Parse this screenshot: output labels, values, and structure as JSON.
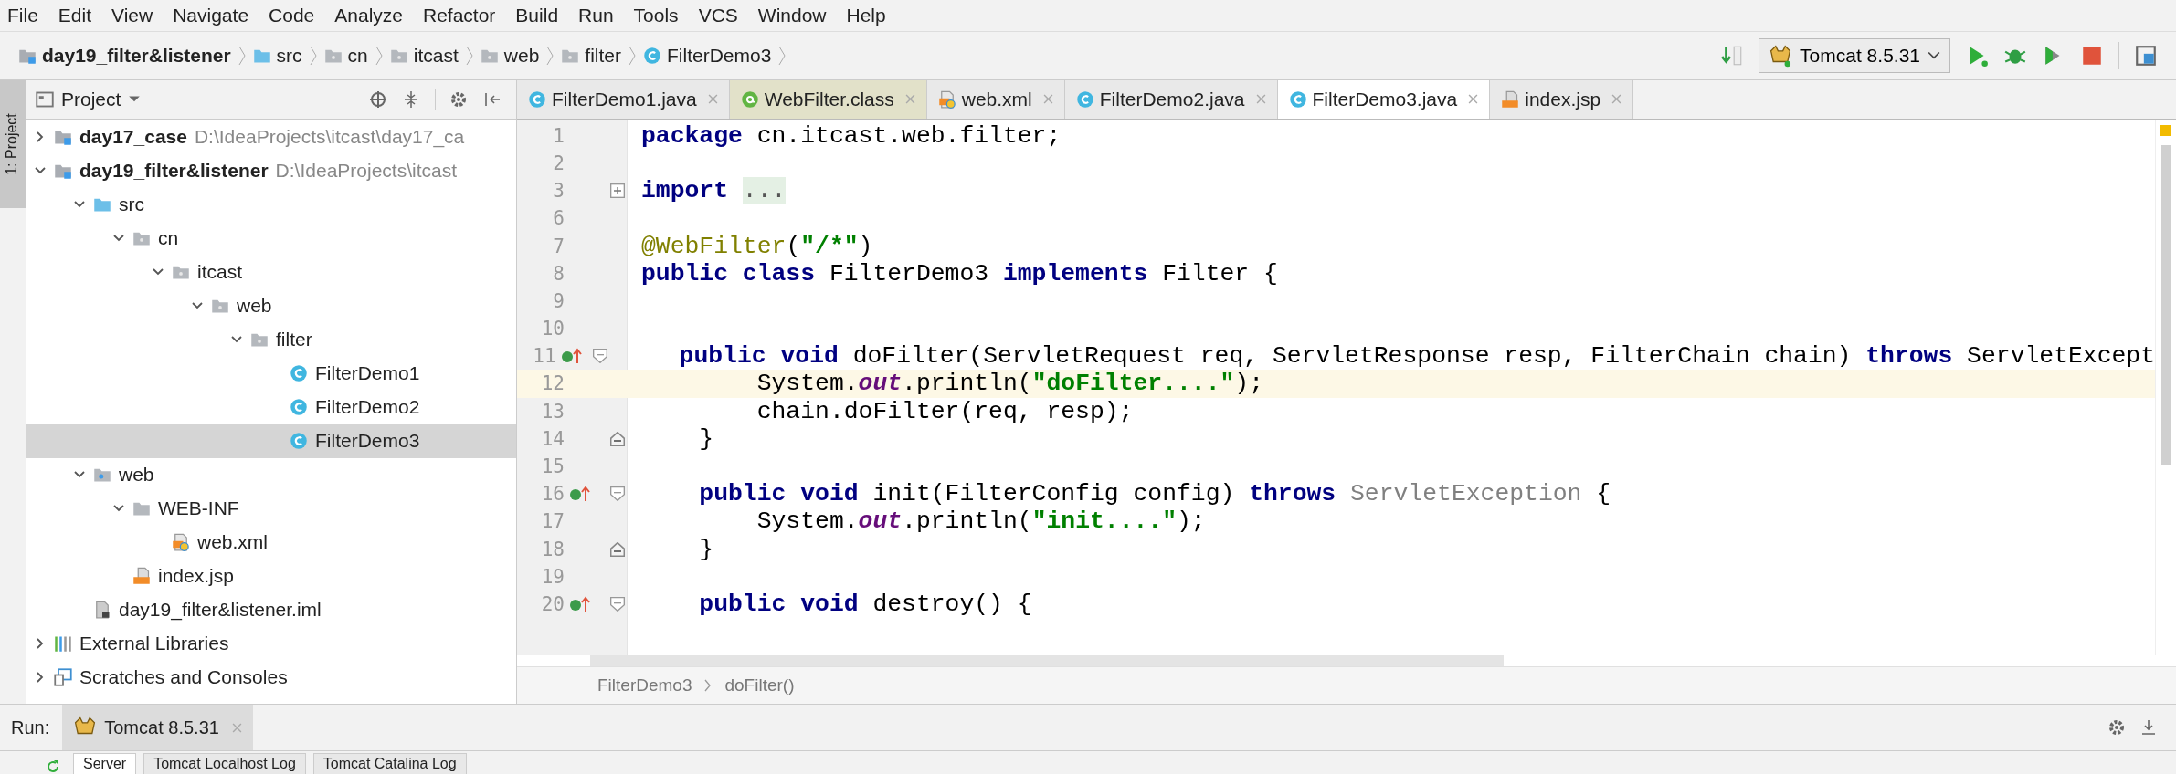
{
  "menu": [
    "File",
    "Edit",
    "View",
    "Navigate",
    "Code",
    "Analyze",
    "Refactor",
    "Build",
    "Run",
    "Tools",
    "VCS",
    "Window",
    "Help"
  ],
  "breadcrumb": [
    {
      "label": "day19_filter&listener",
      "kind": "module"
    },
    {
      "label": "src",
      "kind": "source"
    },
    {
      "label": "cn",
      "kind": "package"
    },
    {
      "label": "itcast",
      "kind": "package"
    },
    {
      "label": "web",
      "kind": "package"
    },
    {
      "label": "filter",
      "kind": "package"
    },
    {
      "label": "FilterDemo3",
      "kind": "class"
    }
  ],
  "run_config": {
    "label": "Tomcat 8.5.31"
  },
  "side_strip": {
    "label": "1: Project",
    "selected": true
  },
  "project_panel": {
    "title": "Project",
    "tree": [
      {
        "label": "day17_case",
        "detail": "D:\\IdeaProjects\\itcast\\day17_ca",
        "kind": "module",
        "expanded": false,
        "selected": false
      },
      {
        "label": "day19_filter&listener",
        "detail": "D:\\IdeaProjects\\itcast",
        "kind": "module",
        "expanded": true,
        "selected": false,
        "children": [
          {
            "label": "src",
            "kind": "source",
            "expanded": true,
            "selected": false,
            "children": [
              {
                "label": "cn",
                "kind": "package",
                "expanded": true,
                "selected": false,
                "children": [
                  {
                    "label": "itcast",
                    "kind": "package",
                    "expanded": true,
                    "selected": false,
                    "children": [
                      {
                        "label": "web",
                        "kind": "package",
                        "expanded": true,
                        "selected": false,
                        "children": [
                          {
                            "label": "filter",
                            "kind": "package",
                            "expanded": true,
                            "selected": false,
                            "children": [
                              {
                                "label": "FilterDemo1",
                                "kind": "class",
                                "selected": false
                              },
                              {
                                "label": "FilterDemo2",
                                "kind": "class",
                                "selected": false
                              },
                              {
                                "label": "FilterDemo3",
                                "kind": "class",
                                "selected": true
                              }
                            ]
                          }
                        ]
                      }
                    ]
                  }
                ]
              }
            ]
          },
          {
            "label": "web",
            "kind": "webroot",
            "expanded": true,
            "selected": false,
            "children": [
              {
                "label": "WEB-INF",
                "kind": "folder",
                "expanded": true,
                "selected": false,
                "children": [
                  {
                    "label": "web.xml",
                    "kind": "xml",
                    "selected": false
                  }
                ]
              },
              {
                "label": "index.jsp",
                "kind": "jsp",
                "selected": false
              }
            ]
          },
          {
            "label": "day19_filter&listener.iml",
            "kind": "iml",
            "selected": false
          }
        ]
      },
      {
        "label": "External Libraries",
        "kind": "libraries",
        "expanded": false,
        "selected": false
      },
      {
        "label": "Scratches and Consoles",
        "kind": "scratches",
        "expanded": false,
        "selected": false
      }
    ]
  },
  "tabs": [
    {
      "label": "FilterDemo1.java",
      "kind": "class",
      "selected": false
    },
    {
      "label": "WebFilter.class",
      "kind": "annotation",
      "selected": false
    },
    {
      "label": "web.xml",
      "kind": "xml",
      "selected": false
    },
    {
      "label": "FilterDemo2.java",
      "kind": "class",
      "selected": false
    },
    {
      "label": "FilterDemo3.java",
      "kind": "class",
      "selected": true
    },
    {
      "label": "index.jsp",
      "kind": "jsp",
      "selected": false
    }
  ],
  "editor": {
    "lines": [
      {
        "number": "1",
        "current": false,
        "overrides": false,
        "fold_start": false,
        "fold_end": false,
        "collapsed": false,
        "tokens": [
          {
            "kind": "kw",
            "text": "package"
          },
          {
            "kind": "plain",
            "text": " cn.itcast.web.filter;"
          }
        ]
      },
      {
        "number": "2",
        "current": false,
        "overrides": false,
        "fold_start": false,
        "fold_end": false,
        "collapsed": false
      },
      {
        "number": "3",
        "current": false,
        "overrides": false,
        "fold_start": false,
        "fold_end": false,
        "collapsed": true,
        "tokens": [
          {
            "kind": "kw",
            "text": "import "
          },
          {
            "kind": "folded",
            "text": "..."
          }
        ]
      },
      {
        "number": "6",
        "current": false,
        "overrides": false,
        "fold_start": false,
        "fold_end": false,
        "collapsed": false
      },
      {
        "number": "7",
        "current": false,
        "overrides": false,
        "fold_start": false,
        "fold_end": false,
        "collapsed": false,
        "tokens": [
          {
            "kind": "ann",
            "text": "@WebFilter"
          },
          {
            "kind": "plain",
            "text": "("
          },
          {
            "kind": "str",
            "text": "\"/*\""
          },
          {
            "kind": "plain",
            "text": ")"
          }
        ]
      },
      {
        "number": "8",
        "current": false,
        "overrides": false,
        "fold_start": false,
        "fold_end": false,
        "collapsed": false,
        "tokens": [
          {
            "kind": "kw",
            "text": "public class"
          },
          {
            "kind": "plain",
            "text": " FilterDemo3 "
          },
          {
            "kind": "kw",
            "text": "implements"
          },
          {
            "kind": "plain",
            "text": " Filter {"
          }
        ]
      },
      {
        "number": "9",
        "current": false,
        "overrides": false,
        "fold_start": false,
        "fold_end": false,
        "collapsed": false
      },
      {
        "number": "10",
        "current": false,
        "overrides": false,
        "fold_start": false,
        "fold_end": false,
        "collapsed": false
      },
      {
        "number": "11",
        "current": false,
        "overrides": true,
        "fold_start": true,
        "fold_end": false,
        "collapsed": false,
        "tokens": [
          {
            "kind": "kw",
            "text": "    public void"
          },
          {
            "kind": "plain",
            "text": " doFilter(ServletRequest req, ServletResponse resp, FilterChain chain) "
          },
          {
            "kind": "kw",
            "text": "throws"
          },
          {
            "kind": "plain",
            "text": " ServletExcept"
          }
        ]
      },
      {
        "number": "12",
        "current": true,
        "overrides": false,
        "fold_start": false,
        "fold_end": false,
        "collapsed": false,
        "tokens": [
          {
            "kind": "plain",
            "text": "        System."
          },
          {
            "kind": "static",
            "text": "out"
          },
          {
            "kind": "plain",
            "text": ".println("
          },
          {
            "kind": "str",
            "text": "\"doFilter....\""
          },
          {
            "kind": "plain",
            "text": ");"
          }
        ]
      },
      {
        "number": "13",
        "current": false,
        "overrides": false,
        "fold_start": false,
        "fold_end": false,
        "collapsed": false,
        "tokens": [
          {
            "kind": "plain",
            "text": "        chain.doFilter(req, resp);"
          }
        ]
      },
      {
        "number": "14",
        "current": false,
        "overrides": false,
        "fold_start": false,
        "fold_end": true,
        "collapsed": false,
        "tokens": [
          {
            "kind": "plain",
            "text": "    }"
          }
        ]
      },
      {
        "number": "15",
        "current": false,
        "overrides": false,
        "fold_start": false,
        "fold_end": false,
        "collapsed": false
      },
      {
        "number": "16",
        "current": false,
        "overrides": true,
        "fold_start": true,
        "fold_end": false,
        "collapsed": false,
        "tokens": [
          {
            "kind": "kw",
            "text": "    public void"
          },
          {
            "kind": "plain",
            "text": " init(FilterConfig config) "
          },
          {
            "kind": "kw",
            "text": "throws "
          },
          {
            "kind": "unused",
            "text": "ServletException"
          },
          {
            "kind": "plain",
            "text": " {"
          }
        ]
      },
      {
        "number": "17",
        "current": false,
        "overrides": false,
        "fold_start": false,
        "fold_end": false,
        "collapsed": false,
        "tokens": [
          {
            "kind": "plain",
            "text": "        System."
          },
          {
            "kind": "static",
            "text": "out"
          },
          {
            "kind": "plain",
            "text": ".println("
          },
          {
            "kind": "str",
            "text": "\"init....\""
          },
          {
            "kind": "plain",
            "text": ");"
          }
        ]
      },
      {
        "number": "18",
        "current": false,
        "overrides": false,
        "fold_start": false,
        "fold_end": true,
        "collapsed": false,
        "tokens": [
          {
            "kind": "plain",
            "text": "    }"
          }
        ]
      },
      {
        "number": "19",
        "current": false,
        "overrides": false,
        "fold_start": false,
        "fold_end": false,
        "collapsed": false
      },
      {
        "number": "20",
        "current": false,
        "overrides": true,
        "fold_start": true,
        "fold_end": false,
        "collapsed": false,
        "tokens": [
          {
            "kind": "kw",
            "text": "    public void"
          },
          {
            "kind": "plain",
            "text": " destroy() {"
          }
        ]
      }
    ],
    "breadcrumb": [
      "FilterDemo3",
      "doFilter()"
    ]
  },
  "run_bar": {
    "label": "Run:",
    "tab": "Tomcat 8.5.31"
  },
  "run_tabs": [
    {
      "label": "Server",
      "selected": true
    },
    {
      "label": "Tomcat Localhost Log",
      "selected": false
    },
    {
      "label": "Tomcat Catalina Log",
      "selected": false
    }
  ]
}
